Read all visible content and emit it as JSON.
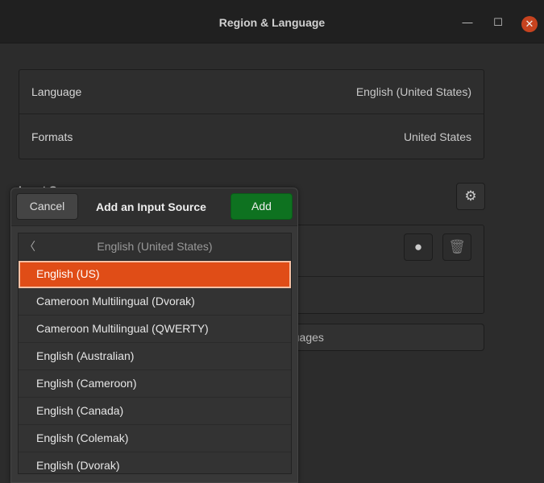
{
  "window": {
    "title": "Region & Language",
    "minimize": "—",
    "maximize": "☐",
    "close": "✕"
  },
  "settings": {
    "rows": [
      {
        "label": "Language",
        "value": "English (United States)"
      },
      {
        "label": "Formats",
        "value": "United States"
      }
    ],
    "input_sources_heading": "Input Sources",
    "manage_languages": "Manage Installed Languages"
  },
  "popover": {
    "cancel": "Cancel",
    "title": "Add an Input Source",
    "add": "Add",
    "back_label": "English (United States)",
    "items": [
      "English (US)",
      "Cameroon Multilingual (Dvorak)",
      "Cameroon Multilingual (QWERTY)",
      "English (Australian)",
      "English (Cameroon)",
      "English (Canada)",
      "English (Colemak)",
      "English (Dvorak)"
    ],
    "selected_index": 0
  },
  "colors": {
    "accent": "#e04d17",
    "add": "#0e7220",
    "close": "#c7431f"
  }
}
